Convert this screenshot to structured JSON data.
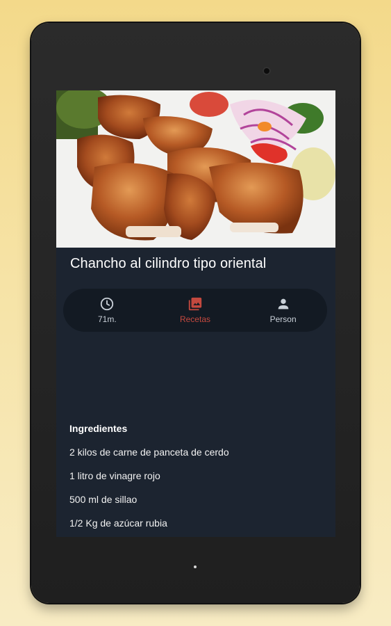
{
  "recipe": {
    "title": "Chancho al cilindro tipo oriental",
    "image": "roasted-pork-dish"
  },
  "tabs": [
    {
      "label": "71m.",
      "icon": "clock-icon",
      "active": false
    },
    {
      "label": "Recetas",
      "icon": "photo-library-icon",
      "active": true
    },
    {
      "label": "Person",
      "icon": "person-icon",
      "active": false
    }
  ],
  "ingredients": {
    "heading": "Ingredientes",
    "items": [
      "2 kilos de carne de panceta de cerdo",
      "1 litro de vinagre rojo",
      "500 ml de sillao",
      "1/2 Kg de azúcar rubia"
    ]
  },
  "colors": {
    "background": "#f3d98a",
    "screen": "#1c2430",
    "tab_bar": "#131a23",
    "accent": "#c4493f"
  }
}
